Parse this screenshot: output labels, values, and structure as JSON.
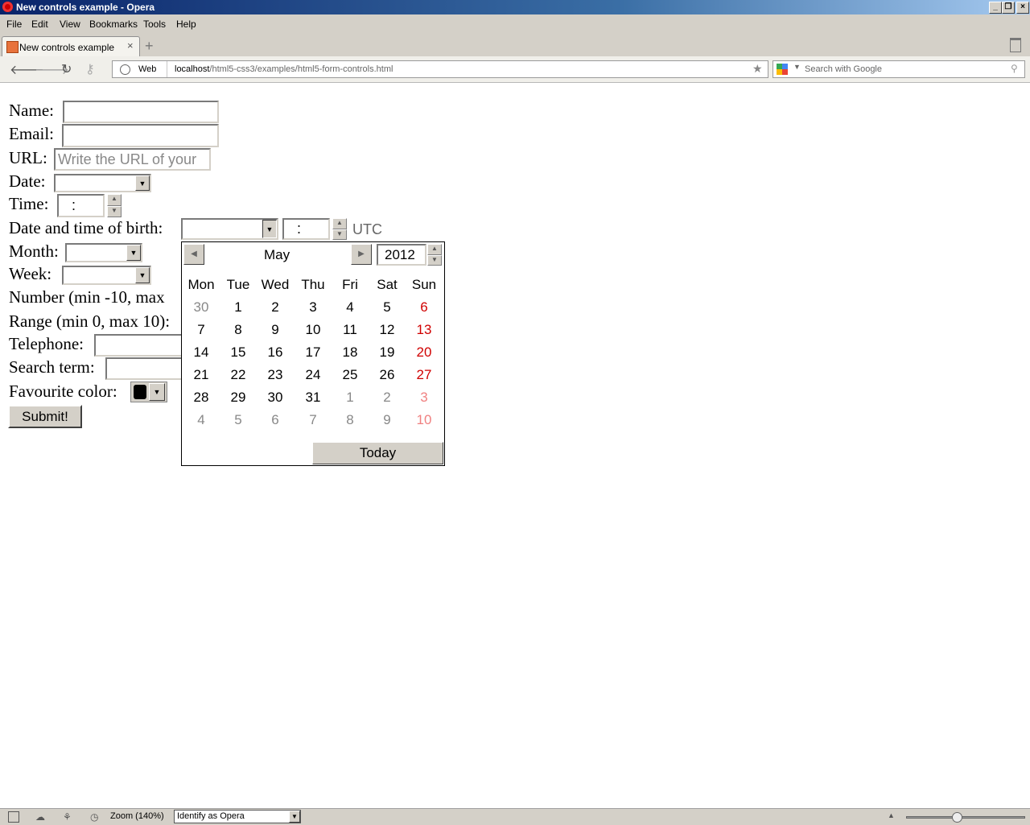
{
  "window": {
    "title": "New controls example - Opera"
  },
  "menu": [
    "File",
    "Edit",
    "View",
    "Bookmarks",
    "Tools",
    "Help"
  ],
  "tab": {
    "label": "New controls example",
    "close": "×"
  },
  "address": {
    "web_label": "Web",
    "host": "localhost",
    "path": "/html5-css3/examples/html5-form-controls.html"
  },
  "search": {
    "placeholder": "Search with Google"
  },
  "form": {
    "name_label": "Name:",
    "email_label": "Email:",
    "url_label": "URL:",
    "url_placeholder": "Write  the  URL  of  your",
    "date_label": "Date:",
    "time_label": "Time:",
    "time_value": ":",
    "datetime_label": "Date and time of birth:",
    "datetime_time_value": ":",
    "utc_label": "UTC",
    "month_label": "Month:",
    "week_label": "Week:",
    "number_label": "Number (min -10, max",
    "range_label": "Range (min 0, max 10):",
    "telephone_label": "Telephone:",
    "search_label": "Search term:",
    "color_label": "Favourite color:",
    "color_value": "#000000",
    "submit_label": "Submit!"
  },
  "calendar": {
    "month": "May",
    "year": "2012",
    "weekdays": [
      "Mon",
      "Tue",
      "Wed",
      "Thu",
      "Fri",
      "Sat",
      "Sun"
    ],
    "weeks": [
      [
        "30",
        "1",
        "2",
        "3",
        "4",
        "5",
        "6"
      ],
      [
        "7",
        "8",
        "9",
        "10",
        "11",
        "12",
        "13"
      ],
      [
        "14",
        "15",
        "16",
        "17",
        "18",
        "19",
        "20"
      ],
      [
        "21",
        "22",
        "23",
        "24",
        "25",
        "26",
        "27"
      ],
      [
        "28",
        "29",
        "30",
        "31",
        "1",
        "2",
        "3"
      ],
      [
        "4",
        "5",
        "6",
        "7",
        "8",
        "9",
        "10"
      ]
    ],
    "today_label": "Today"
  },
  "status": {
    "zoom": "Zoom (140%)",
    "identify": "Identify as Opera"
  }
}
